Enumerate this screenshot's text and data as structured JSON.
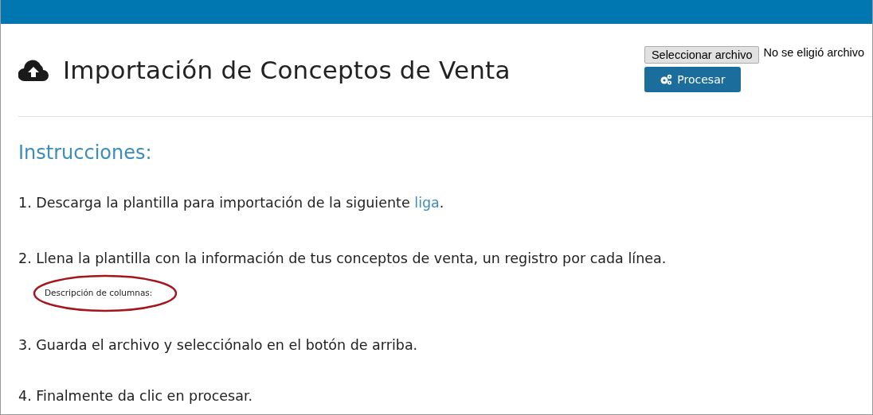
{
  "header": {
    "title": "Importación de Conceptos de Venta"
  },
  "file_picker": {
    "button": "Seleccionar archivo",
    "status": "No se eligió archivo"
  },
  "process_button": {
    "label": "Procesar"
  },
  "instructions": {
    "heading": "Instrucciones:",
    "steps": [
      {
        "text": "1. Descarga la plantilla para importación de la siguiente ",
        "link": "liga",
        "after": "."
      },
      {
        "text": "2. Llena la plantilla con la información de tus conceptos de venta, un registro por cada línea.",
        "note": "Descripción de columnas:"
      },
      {
        "text": "3. Guarda el archivo y selecciónalo en el botón de arriba."
      },
      {
        "text": "4. Finalmente da clic en procesar."
      }
    ]
  }
}
